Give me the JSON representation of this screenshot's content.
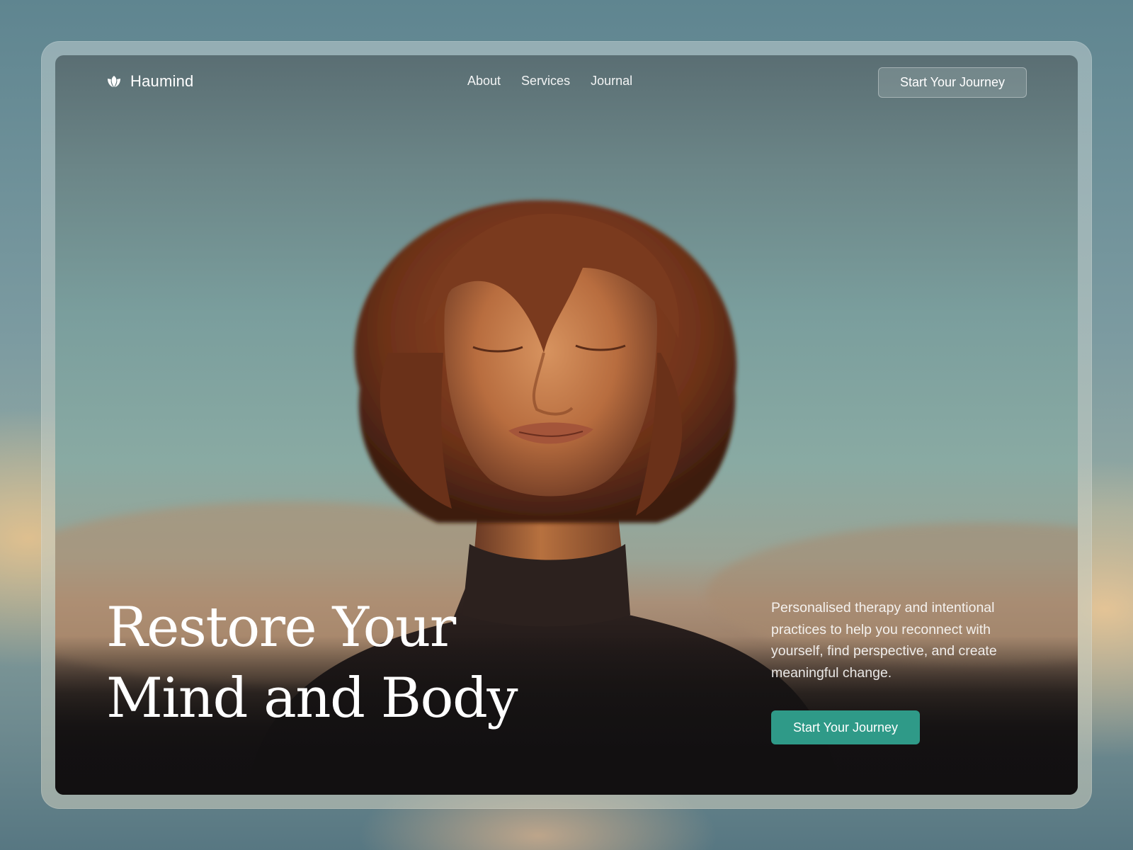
{
  "brand": {
    "name": "Haumind",
    "logo_icon": "lotus-leaf-icon"
  },
  "nav": {
    "links": [
      "About",
      "Services",
      "Journal"
    ],
    "cta_label": "Start Your Journey"
  },
  "hero": {
    "headline_line1": "Restore Your",
    "headline_line2": "Mind and Body",
    "description": "Personalised therapy and intentional practices to help you reconnect with yourself, find perspective, and create meaningful change.",
    "cta_label": "Start Your Journey",
    "image": "portrait-of-woman-with-closed-eyes-in-desert-sunlight"
  },
  "colors": {
    "accent": "#2f9a88",
    "text": "#ffffff"
  }
}
